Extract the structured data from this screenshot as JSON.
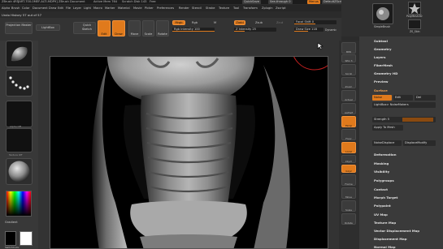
{
  "titlebar": {
    "app": "ZBrush 4R5",
    "file": "[ART-700-0MEF-ALTI-MDP9]",
    "document": "ZBrush Document",
    "active": "Active Mem 764",
    "scratch": "Scratch Disk 143",
    "free": "Free",
    "quicksave": "QuickSave",
    "seethrough": "See-through  0",
    "menus": "Menus",
    "default_script": "DefaultZScript"
  },
  "menubar": [
    "Alpha",
    "Brush",
    "Color",
    "Document",
    "Draw",
    "Edit",
    "File",
    "Layer",
    "Light",
    "Macro",
    "Marker",
    "Material",
    "Movie",
    "Picker",
    "Preferences",
    "Render",
    "Stencil",
    "Stroke",
    "Texture",
    "Tool",
    "Transform",
    "Zplugin",
    "Zscript"
  ],
  "status": {
    "undo_history": "Undo History 57 out of 57"
  },
  "shelf": {
    "projection_master": "Projection Master",
    "lightbox": "LightBox",
    "quick_sketch": "Quick Sketch",
    "edit": "Edit",
    "draw": "Draw",
    "move": "Move",
    "scale": "Scale",
    "rotate": "Rotate",
    "mrgb": "Mrgb",
    "rgb": "Rgb",
    "m": "M",
    "zadd": "Zadd",
    "zsub": "Zsub",
    "zcut": "Zcut",
    "rgb_intensity": "Rgb Intensity 100",
    "z_intensity": "Z Intensity 25",
    "focal_shift": "Focal Shift 0",
    "draw_size": "Draw Size 118",
    "dynamic": "Dynamic"
  },
  "shelf_values": {
    "rgb_intensity": 1.0,
    "z_intensity": 0.25,
    "focal_shift": 0.5,
    "draw_size": 0.47
  },
  "right_top": {
    "tool_label": "PolyMesh3D",
    "brush_label": "SimpleBrush",
    "zsketch_label": "ZS_Skin"
  },
  "left_tray": {
    "texture_off": "Texture Off",
    "alpha_off": "Alpha Off",
    "gradient": "Gradient",
    "switch_color": "SwitchColor"
  },
  "vshelf": [
    "BPR",
    "SPix 3",
    "Scroll",
    "Zoom",
    "Actual",
    "AAHalf",
    "Persp",
    "Floor",
    "Local",
    "LSym",
    "Gxyz",
    "Frame",
    "Move",
    "Scale",
    "Rotate"
  ],
  "rpal": {
    "subtool": "Subtool",
    "geometry": "Geometry",
    "layers": "Layers",
    "fibermesh": "FiberMesh",
    "geometry_hd": "Geometry HD",
    "preview": "Preview",
    "surface": "Surface",
    "noise": "Noise",
    "edit": "Edit",
    "del": "Del",
    "lightbox_noisemakers": "LightBox> NoiseMakers",
    "strength": "Strength 5",
    "apply_to_mesh": "Apply To Mesh",
    "noise_displace": "NoiseDisplace",
    "displace_modify": "DisplaceModify",
    "deformation": "Deformation",
    "masking": "Masking",
    "visibility": "Visibility",
    "polygroups": "Polygroups",
    "contact": "Contact",
    "morph_target": "Morph Target",
    "polypaint": "Polypaint",
    "uv_map": "UV Map",
    "texture_map": "Texture Map",
    "vector_displacement_map": "Vector Displacement Map",
    "displacement_map": "Displacement Map",
    "normal_map": "Normal Map"
  },
  "colors": {
    "accent": "#e07a1c",
    "panel": "#3a3a3a",
    "canvas": "#000000"
  }
}
